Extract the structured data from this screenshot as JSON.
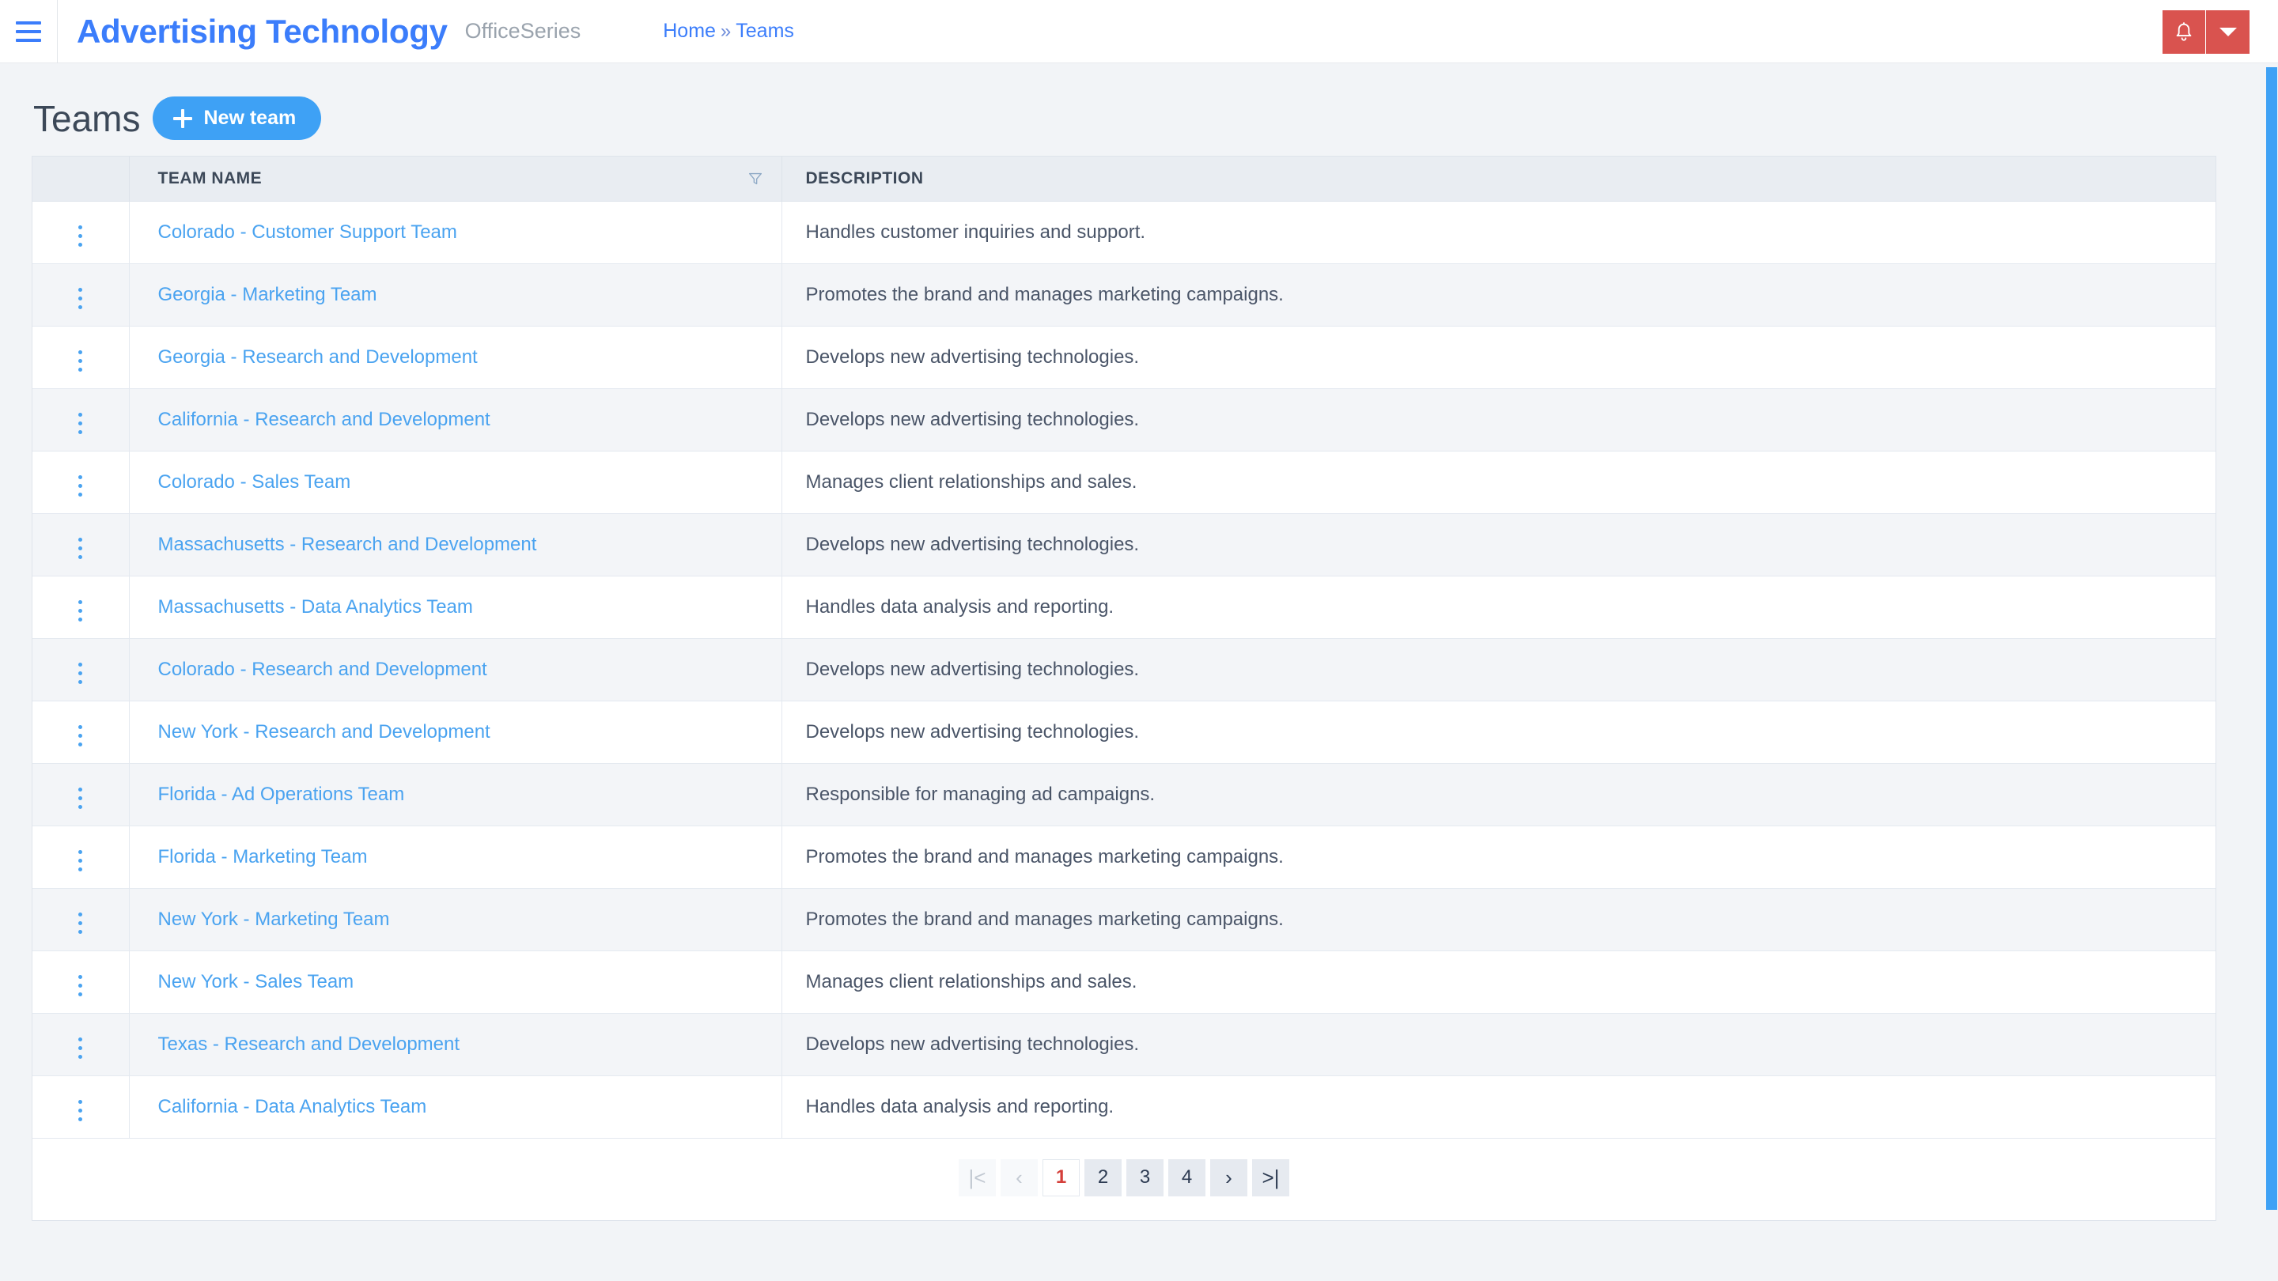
{
  "topbar": {
    "menu_icon": "hamburger-icon",
    "brand": "Advertising Technology",
    "brand_sub": "OfficeSeries",
    "breadcrumb": {
      "home": "Home",
      "separator": "»",
      "current": "Teams"
    },
    "notification_icon": "bell-icon",
    "dropdown_icon": "caret-down-icon",
    "accent_red": "#d9534f",
    "accent_blue": "#3b7dfb"
  },
  "page": {
    "title": "Teams",
    "new_button": "New team",
    "new_button_icon": "plus-icon",
    "new_button_color": "#3ea1f5"
  },
  "table": {
    "columns": [
      "",
      "TEAM NAME",
      "DESCRIPTION"
    ],
    "filter_icon": "funnel-filter-icon",
    "row_menu_icon": "kebab-menu-icon",
    "rows": [
      {
        "name": "Colorado - Customer Support Team",
        "description": "Handles customer inquiries and support."
      },
      {
        "name": "Georgia - Marketing Team",
        "description": "Promotes the brand and manages marketing campaigns."
      },
      {
        "name": "Georgia - Research and Development",
        "description": "Develops new advertising technologies."
      },
      {
        "name": "California - Research and Development",
        "description": "Develops new advertising technologies."
      },
      {
        "name": "Colorado - Sales Team",
        "description": "Manages client relationships and sales."
      },
      {
        "name": "Massachusetts - Research and Development",
        "description": "Develops new advertising technologies."
      },
      {
        "name": "Massachusetts - Data Analytics Team",
        "description": "Handles data analysis and reporting."
      },
      {
        "name": "Colorado - Research and Development",
        "description": "Develops new advertising technologies."
      },
      {
        "name": "New York - Research and Development",
        "description": "Develops new advertising technologies."
      },
      {
        "name": "Florida - Ad Operations Team",
        "description": "Responsible for managing ad campaigns."
      },
      {
        "name": "Florida - Marketing Team",
        "description": "Promotes the brand and manages marketing campaigns."
      },
      {
        "name": "New York - Marketing Team",
        "description": "Promotes the brand and manages marketing campaigns."
      },
      {
        "name": "New York - Sales Team",
        "description": "Manages client relationships and sales."
      },
      {
        "name": "Texas - Research and Development",
        "description": "Develops new advertising technologies."
      },
      {
        "name": "California - Data Analytics Team",
        "description": "Handles data analysis and reporting."
      }
    ]
  },
  "pagination": {
    "first": "|<",
    "prev": "‹",
    "pages": [
      "1",
      "2",
      "3",
      "4"
    ],
    "active_page": "1",
    "next": "›",
    "last": ">|",
    "active_color": "#d43f3a"
  }
}
